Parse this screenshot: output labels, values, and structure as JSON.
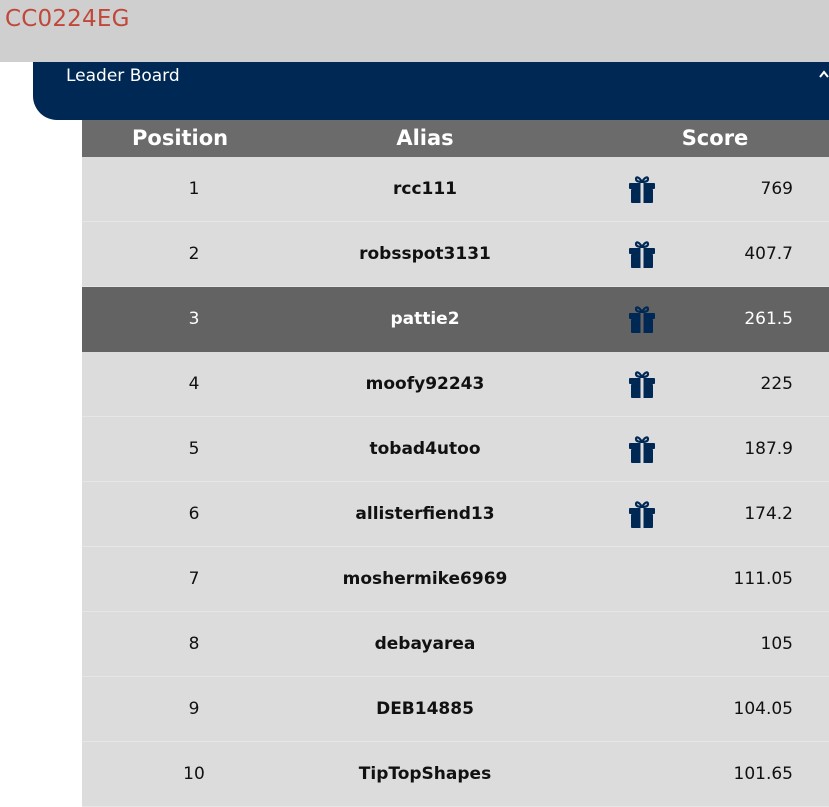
{
  "app": {
    "code": "CC0224EG"
  },
  "panel": {
    "title": "Leader Board",
    "collapse_icon": "chevron-up-icon"
  },
  "table": {
    "headers": {
      "position": "Position",
      "alias": "Alias",
      "score": "Score"
    },
    "rows": [
      {
        "position": "1",
        "alias": "rcc111",
        "score": "769",
        "gift": true,
        "highlight": false
      },
      {
        "position": "2",
        "alias": "robsspot3131",
        "score": "407.7",
        "gift": true,
        "highlight": false
      },
      {
        "position": "3",
        "alias": "pattie2",
        "score": "261.5",
        "gift": true,
        "highlight": true
      },
      {
        "position": "4",
        "alias": "moofy92243",
        "score": "225",
        "gift": true,
        "highlight": false
      },
      {
        "position": "5",
        "alias": "tobad4utoo",
        "score": "187.9",
        "gift": true,
        "highlight": false
      },
      {
        "position": "6",
        "alias": "allisterfiend13",
        "score": "174.2",
        "gift": true,
        "highlight": false
      },
      {
        "position": "7",
        "alias": "moshermike6969",
        "score": "111.05",
        "gift": false,
        "highlight": false
      },
      {
        "position": "8",
        "alias": "debayarea",
        "score": "105",
        "gift": false,
        "highlight": false
      },
      {
        "position": "9",
        "alias": "DEB14885",
        "score": "104.05",
        "gift": false,
        "highlight": false
      },
      {
        "position": "10",
        "alias": "TipTopShapes",
        "score": "101.65",
        "gift": false,
        "highlight": false
      }
    ]
  },
  "colors": {
    "code": "#c0473a",
    "header_bg": "#002855",
    "table_header_bg": "#6b6b6b",
    "row_bg": "#dcdcdc",
    "highlight_bg": "#636363",
    "gift_icon": "#002855"
  }
}
